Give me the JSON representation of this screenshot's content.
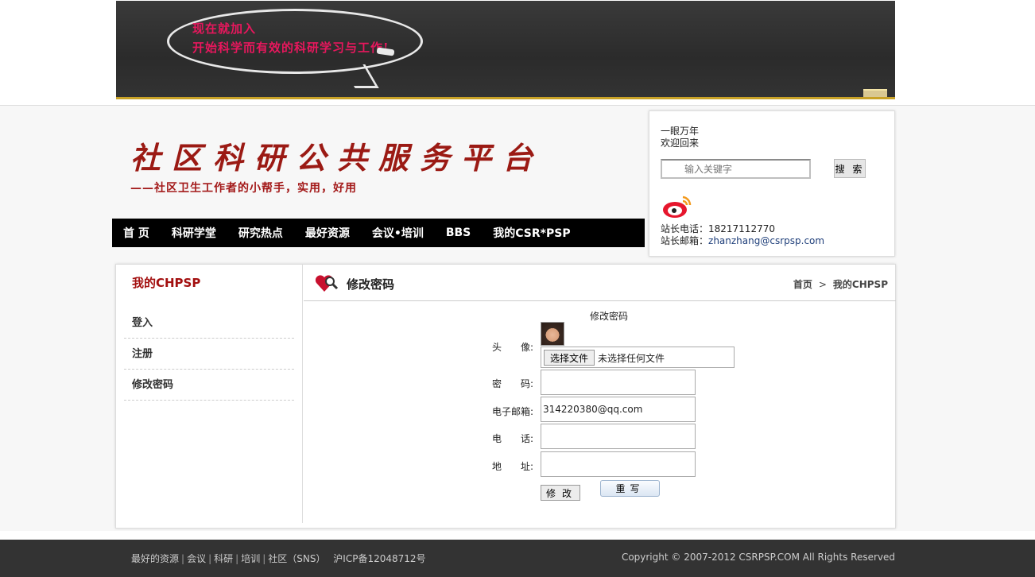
{
  "banner": {
    "slogan_line1": "现在就加入",
    "slogan_line2": "开始科学而有效的科研学习与工作!"
  },
  "site": {
    "title": "社区科研公共服务平台",
    "subtitle": "——社区卫生工作者的小帮手，实用，好用"
  },
  "nav": {
    "items": [
      {
        "label": "首 页"
      },
      {
        "label": "科研学堂"
      },
      {
        "label": "研究热点"
      },
      {
        "label": "最好资源"
      },
      {
        "label": "会议•培训"
      },
      {
        "label": "BBS"
      },
      {
        "label": "我的CSR*PSP"
      }
    ]
  },
  "info": {
    "user": "一眼万年",
    "welcome": "欢迎回来",
    "search_placeholder": "输入关键字",
    "search_button": "搜 索",
    "phone_line": "站长电话：18217112770",
    "email_label": "站长邮箱：",
    "email_value": "zhanzhang@csrpsp.com"
  },
  "sidebar": {
    "title": "我的CHPSP",
    "items": [
      {
        "label": "登入"
      },
      {
        "label": "注册"
      },
      {
        "label": "修改密码"
      }
    ]
  },
  "content": {
    "title": "修改密码",
    "breadcrumb": {
      "home": "首页",
      "sep": ">",
      "current": "我的CHPSP"
    }
  },
  "form": {
    "title": "修改密码",
    "avatar_label": "头　　像:",
    "file_button": "选择文件",
    "file_status": "未选择任何文件",
    "password_label": "密　　码:",
    "password_value": "",
    "email_label": "电子邮箱:",
    "email_value": "314220380@qq.com",
    "phone_label": "电　　话:",
    "phone_value": "",
    "address_label": "地　　址:",
    "address_value": "",
    "submit_label": "修改",
    "reset_label": "重写"
  },
  "footer": {
    "links": [
      {
        "label": "最好的资源"
      },
      {
        "label": "会议"
      },
      {
        "label": "科研"
      },
      {
        "label": "培训"
      },
      {
        "label": "社区（SNS）"
      }
    ],
    "sep": "|",
    "icp": "沪ICP备12048712号",
    "copyright": "Copyright © 2007-2012 CSRPSP.COM All Rights Reserved"
  },
  "colors": {
    "brand_red": "#9b1a14",
    "slogan_pink": "#e8175d",
    "nav_bg": "#000000",
    "footer_bg": "#333333"
  }
}
